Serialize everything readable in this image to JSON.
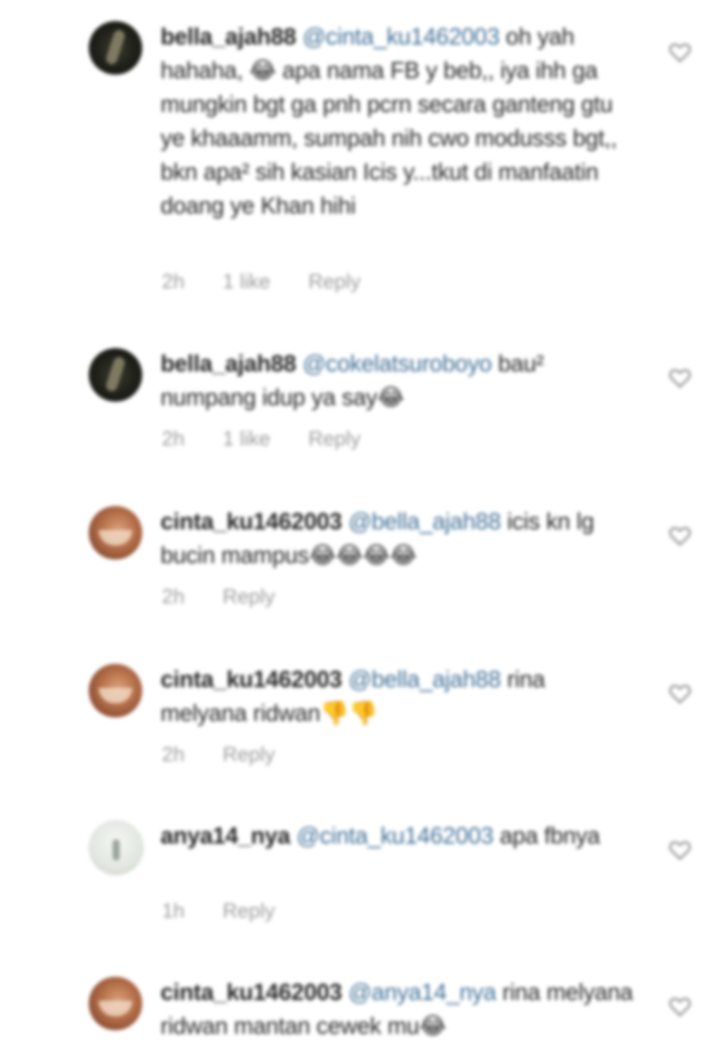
{
  "comments": [
    {
      "username": "bella_ajah88",
      "mention": "@cinta_ku1462003",
      "text": " oh yah hahaha, 😂 apa nama FB y beb,, iya ihh ga mungkin bgt ga pnh pcrn secara ganteng gtu ye khaaamm, sumpah nih cwo modusss bgt,, bkn apa² sih kasian Icis y...tkut di manfaatin doang ye Khan hihi",
      "time": "2h",
      "likes": "1 like",
      "reply": "Reply"
    },
    {
      "username": "bella_ajah88",
      "mention": "@cokelatsuroboyo",
      "text": " bau² numpang idup ya say😂",
      "time": "2h",
      "likes": "1 like",
      "reply": "Reply"
    },
    {
      "username": "cinta_ku1462003",
      "mention": "@bella_ajah88",
      "text": " icis kn lg bucin mampus😂😂😂😂",
      "time": "2h",
      "likes": "",
      "reply": "Reply"
    },
    {
      "username": "cinta_ku1462003",
      "mention": "@bella_ajah88",
      "text": " rina melyana ridwan👎👎",
      "time": "2h",
      "likes": "",
      "reply": "Reply"
    },
    {
      "username": "anya14_nya",
      "mention": "@cinta_ku1462003",
      "text": " apa fbnya",
      "time": "1h",
      "likes": "",
      "reply": "Reply"
    },
    {
      "username": "cinta_ku1462003",
      "mention": "@anya14_nya",
      "text": " rina melyana ridwan mantan cewek mu😂",
      "time": "",
      "likes": "",
      "reply": ""
    }
  ],
  "icons": {
    "avatar": "profile-photo",
    "like": "heart-outline-icon"
  }
}
